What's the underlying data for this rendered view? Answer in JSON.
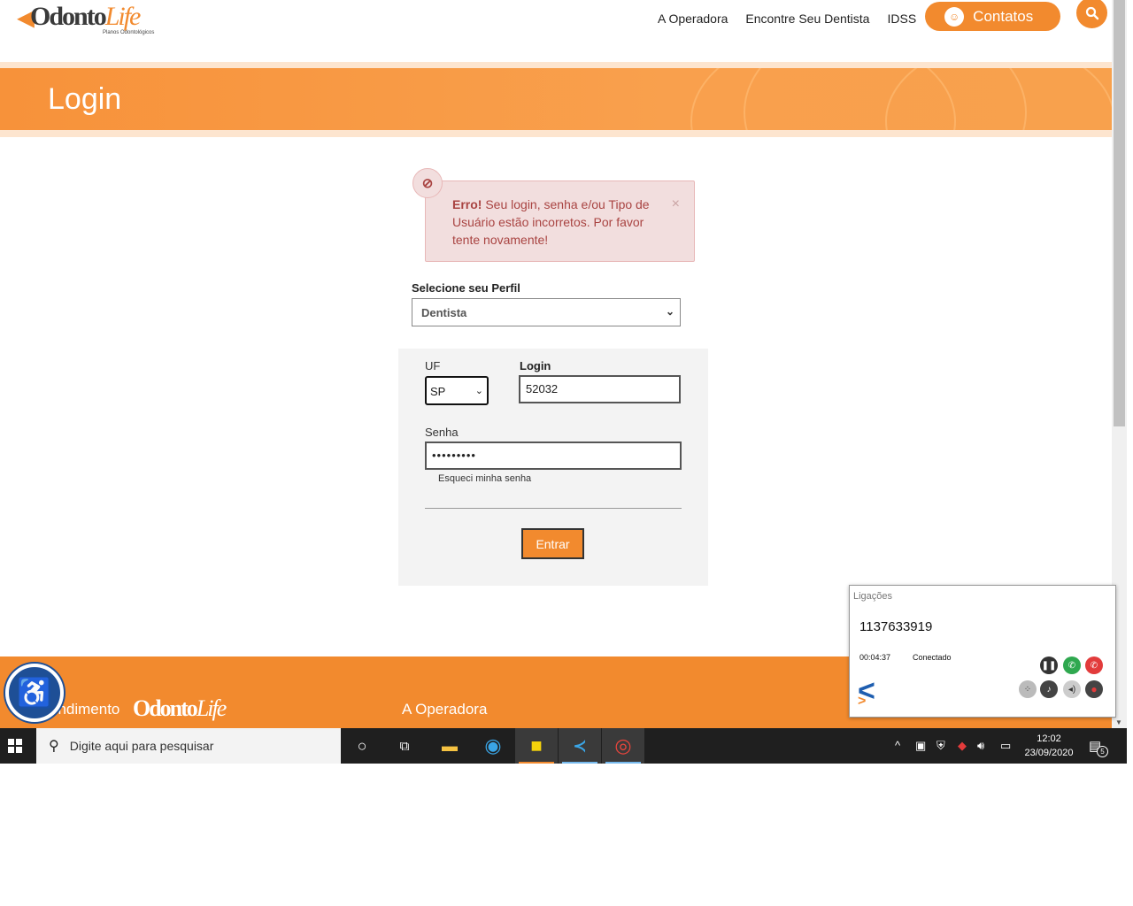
{
  "header": {
    "logo_text_a": "Odonto",
    "logo_text_b": "Life",
    "logo_sub": "Planos Odontológicos",
    "nav": [
      "A Operadora",
      "Encontre Seu Dentista",
      "IDSS"
    ],
    "contacts_label": "Contatos"
  },
  "banner": {
    "title": "Login"
  },
  "alert": {
    "strong": "Erro!",
    "message": " Seu login, senha e/ou Tipo de Usuário estão incorretos. Por favor tente novamente!",
    "close": "×"
  },
  "profile": {
    "label": "Selecione seu Perfil",
    "selected": "Dentista"
  },
  "form": {
    "uf_label": "UF",
    "uf_value": "SP",
    "login_label": "Login",
    "login_value": "52032",
    "password_label": "Senha",
    "password_value": "•••••••••",
    "forgot_label": "Esqueci minha senha",
    "submit_label": "Entrar"
  },
  "footer": {
    "col1": "endimento",
    "logo_text_a": "Odonto",
    "logo_text_b": "Life",
    "col2": "A Operadora"
  },
  "call_widget": {
    "title": "Ligações",
    "number": "1137633919",
    "duration": "00:04:37",
    "status": "Conectado"
  },
  "taskbar": {
    "search_placeholder": "Digite aqui para pesquisar",
    "time": "12:02",
    "date": "23/09/2020",
    "notification_count": "5"
  },
  "colors": {
    "brand_orange": "#f28a2e",
    "alert_bg": "#f2dede",
    "alert_text": "#a94442",
    "a11y_blue": "#1e4f96"
  }
}
